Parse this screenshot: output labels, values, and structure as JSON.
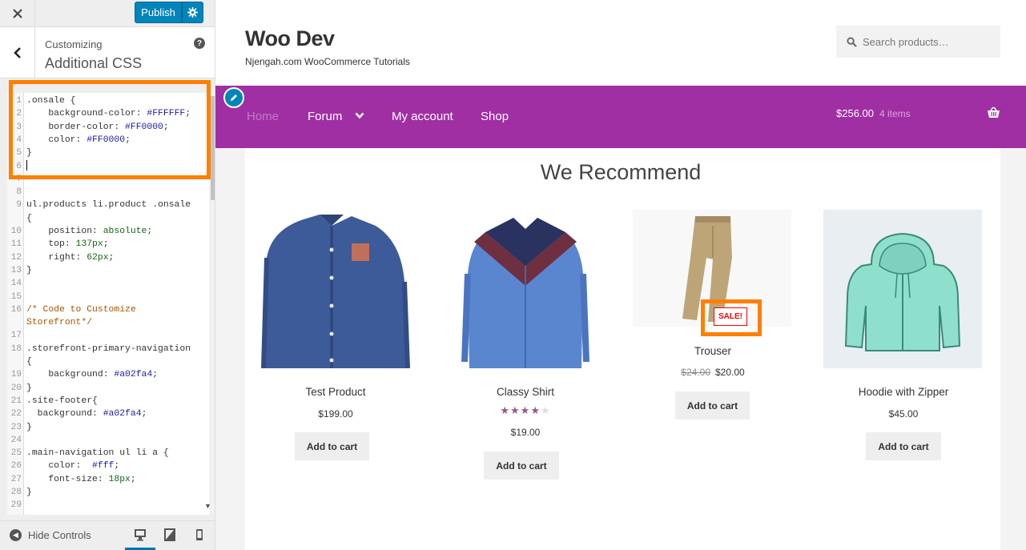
{
  "customizer": {
    "close_icon": "close-icon",
    "publish_label": "Publish",
    "settings_icon": "gear-icon",
    "back_icon": "chevron-left-icon",
    "section_sub": "Customizing",
    "section_title": "Additional CSS",
    "help_label": "?",
    "hide_controls_label": "Hide Controls",
    "devices": [
      "desktop",
      "tablet",
      "mobile"
    ],
    "code_lines": [
      {
        "n": "1",
        "text": ".onsale {"
      },
      {
        "n": "2",
        "text": "    background-color: #FFFFFF;"
      },
      {
        "n": "3",
        "text": "    border-color: #FF0000;"
      },
      {
        "n": "4",
        "text": "    color: #FF0000;"
      },
      {
        "n": "5",
        "text": "}"
      },
      {
        "n": "6",
        "text": ""
      },
      {
        "n": "7",
        "text": ""
      },
      {
        "n": "8",
        "text": ""
      },
      {
        "n": "9",
        "text": "ul.products li.product .onsale"
      },
      {
        "n": "",
        "text": "{"
      },
      {
        "n": "10",
        "text": "    position: absolute;"
      },
      {
        "n": "11",
        "text": "    top: 137px;"
      },
      {
        "n": "12",
        "text": "    right: 62px;"
      },
      {
        "n": "13",
        "text": "}"
      },
      {
        "n": "14",
        "text": ""
      },
      {
        "n": "15",
        "text": ""
      },
      {
        "n": "16",
        "text": "/* Code to Customize"
      },
      {
        "n": "",
        "text": "Storefront*/"
      },
      {
        "n": "17",
        "text": ""
      },
      {
        "n": "18",
        "text": ".storefront-primary-navigation"
      },
      {
        "n": "",
        "text": "{"
      },
      {
        "n": "19",
        "text": "    background: #a02fa4;"
      },
      {
        "n": "20",
        "text": "}"
      },
      {
        "n": "21",
        "text": ".site-footer{"
      },
      {
        "n": "22",
        "text": "  background: #a02fa4;"
      },
      {
        "n": "23",
        "text": "}"
      },
      {
        "n": "24",
        "text": ""
      },
      {
        "n": "25",
        "text": ".main-navigation ul li a {"
      },
      {
        "n": "26",
        "text": "    color:  #fff;"
      },
      {
        "n": "27",
        "text": "    font-size: 18px;"
      },
      {
        "n": "28",
        "text": "}"
      },
      {
        "n": "29",
        "text": ""
      }
    ]
  },
  "site": {
    "title": "Woo Dev",
    "tagline": "Njengah.com WooCommerce Tutorials",
    "search_placeholder": "Search products…",
    "nav": [
      "Home",
      "Forum",
      "My account",
      "Shop"
    ],
    "cart_amount": "$256.00",
    "cart_count": "4 items",
    "section_heading": "We Recommend",
    "nav_color": "#a02fa4",
    "accent_highlight": "#ff7f00"
  },
  "products": [
    {
      "name": "Test Product",
      "price": "$199.00",
      "button": "Add to cart"
    },
    {
      "name": "Classy Shirt",
      "rating": 4,
      "rating_max": 5,
      "price": "$19.00",
      "button": "Add to cart"
    },
    {
      "name": "Trouser",
      "old_price": "$24.00",
      "price": "$20.00",
      "sale_label": "SALE!",
      "button": "Add to cart"
    },
    {
      "name": "Hoodie with Zipper",
      "price": "$45.00",
      "button": "Add to cart"
    }
  ]
}
